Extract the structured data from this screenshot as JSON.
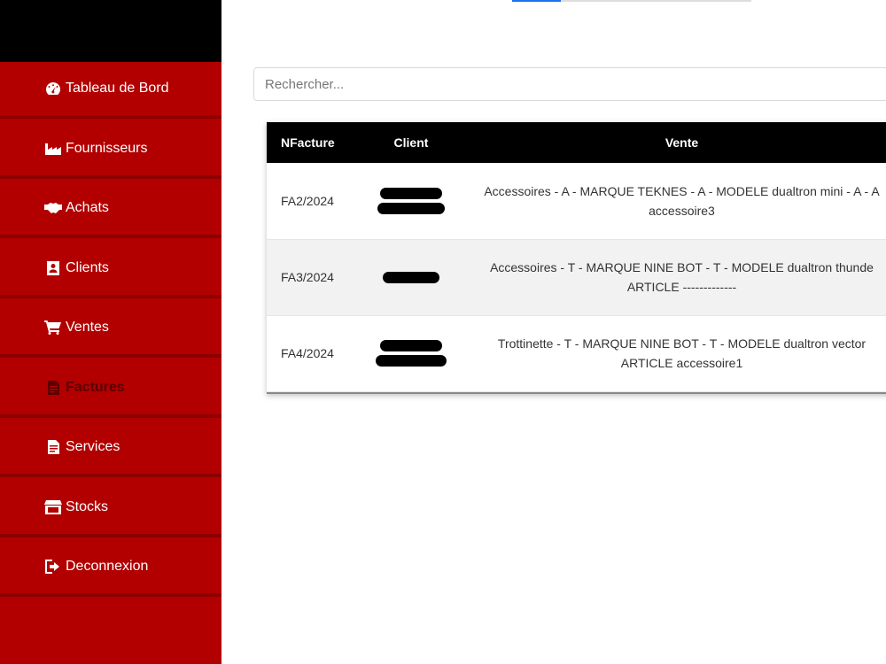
{
  "sidebar": {
    "items": [
      {
        "label": "Tableau de Bord",
        "icon": "dashboard-icon",
        "active": false
      },
      {
        "label": "Fournisseurs",
        "icon": "factory-icon",
        "active": false
      },
      {
        "label": "Achats",
        "icon": "handshake-icon",
        "active": false
      },
      {
        "label": "Clients",
        "icon": "contact-card-icon",
        "active": false
      },
      {
        "label": "Ventes",
        "icon": "cart-icon",
        "active": false
      },
      {
        "label": "Factures",
        "icon": "invoice-icon",
        "active": true
      },
      {
        "label": "Services",
        "icon": "document-icon",
        "active": false
      },
      {
        "label": "Stocks",
        "icon": "store-icon",
        "active": false
      },
      {
        "label": "Deconnexion",
        "icon": "sign-out-icon",
        "active": false
      }
    ]
  },
  "search": {
    "placeholder": "Rechercher..."
  },
  "table": {
    "headers": {
      "nfacture": "NFacture",
      "client": "Client",
      "vente": "Vente"
    },
    "rows": [
      {
        "nfacture": "FA2/2024",
        "vente_line1": "Accessoires - A - MARQUE TEKNES - A - MODELE dualtron mini - A - A",
        "vente_line2": "accessoire3"
      },
      {
        "nfacture": "FA3/2024",
        "vente_line1": "Accessoires - T - MARQUE NINE BOT - T - MODELE dualtron thunde",
        "vente_line2": "ARTICLE -------------"
      },
      {
        "nfacture": "FA4/2024",
        "vente_line1": "Trottinette - T - MARQUE NINE BOT - T - MODELE dualtron vector",
        "vente_line2": "ARTICLE accessoire1"
      }
    ]
  },
  "colors": {
    "sidebar": "#b20000",
    "header": "#000000",
    "active_item": "#5a0000"
  }
}
